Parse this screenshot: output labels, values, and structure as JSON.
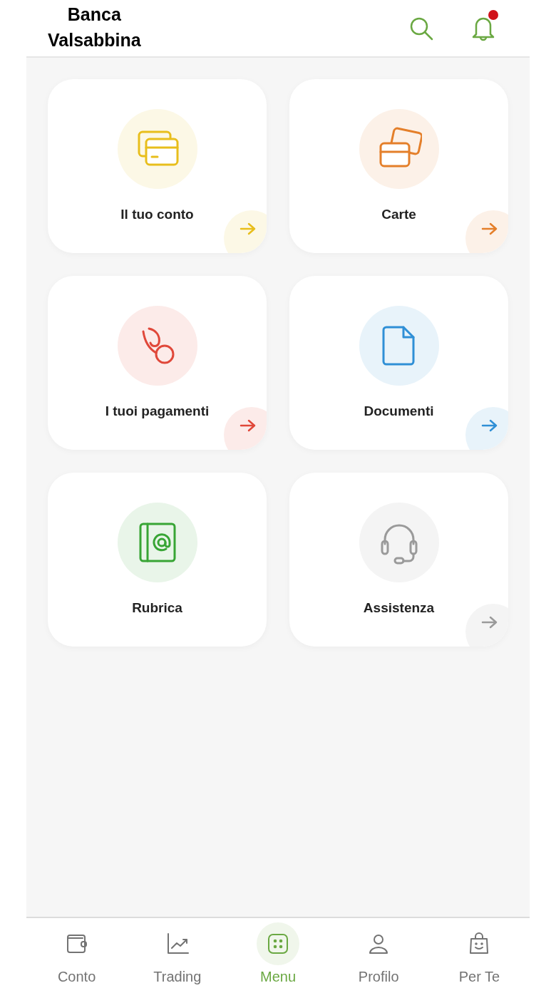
{
  "header": {
    "title_lines": [
      "Banca",
      "Valsabbina"
    ],
    "has_notification": true
  },
  "tiles": [
    {
      "label": "Il tuo conto",
      "color": "#e8be1c",
      "has_arrow": true
    },
    {
      "label": "Carte",
      "color": "#e47f2a",
      "has_arrow": true
    },
    {
      "label": "I tuoi pagamenti",
      "color": "#e0483a",
      "has_arrow": true
    },
    {
      "label": "Documenti",
      "color": "#2f8fd6",
      "has_arrow": true
    },
    {
      "label": "Rubrica",
      "color": "#38a535",
      "has_arrow": false
    },
    {
      "label": "Assistenza",
      "color": "#9a9a9a",
      "has_arrow": true
    }
  ],
  "nav": [
    {
      "label": "Conto",
      "selected": false
    },
    {
      "label": "Trading",
      "selected": false
    },
    {
      "label": "Menu",
      "selected": true
    },
    {
      "label": "Profilo",
      "selected": false
    },
    {
      "label": "Per Te",
      "selected": false
    }
  ]
}
